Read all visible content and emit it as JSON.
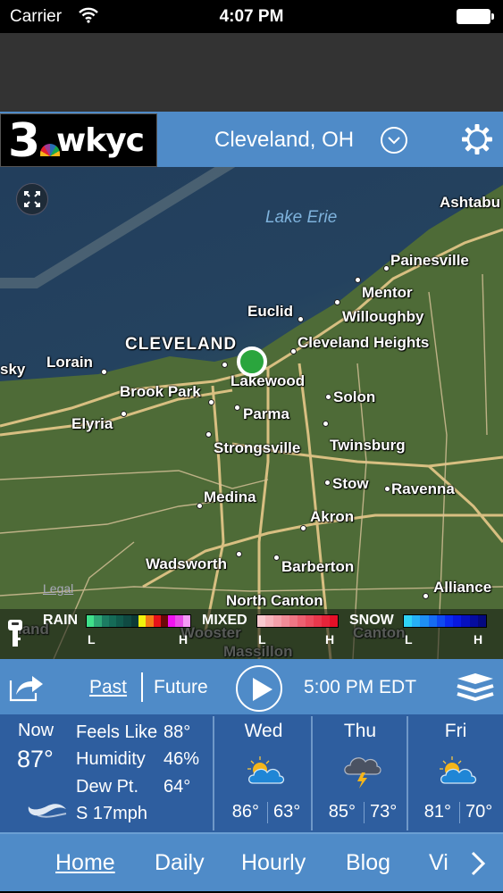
{
  "status_bar": {
    "carrier": "Carrier",
    "time": "4:07 PM",
    "wifi_icon": "wifi-icon",
    "battery_icon": "battery-icon"
  },
  "header": {
    "logo_number": "3",
    "logo_text": "wkyc",
    "location": "Cleveland, OH",
    "location_dropdown_icon": "chevron-down-circle-icon",
    "settings_icon": "gear-icon",
    "brand_color": "#4f8bc8"
  },
  "map": {
    "water_label": "Lake Erie",
    "expand_icon": "expand-icon",
    "legal_link": "Legal",
    "current_location_color": "#2aa53d",
    "cities": [
      {
        "name": "Ashtabu"
      },
      {
        "name": "Painesville"
      },
      {
        "name": "Mentor"
      },
      {
        "name": "Willoughby"
      },
      {
        "name": "Euclid"
      },
      {
        "name": "Cleveland Heights"
      },
      {
        "name": "CLEVELAND"
      },
      {
        "name": "Lorain"
      },
      {
        "name": "sky"
      },
      {
        "name": "Lakewood"
      },
      {
        "name": "Brook Park"
      },
      {
        "name": "Solon"
      },
      {
        "name": "Elyria"
      },
      {
        "name": "Parma"
      },
      {
        "name": "Strongsville"
      },
      {
        "name": "Twinsburg"
      },
      {
        "name": "Stow"
      },
      {
        "name": "Ravenna"
      },
      {
        "name": "Medina"
      },
      {
        "name": "Akron"
      },
      {
        "name": "Wadsworth"
      },
      {
        "name": "Barberton"
      },
      {
        "name": "North Canton"
      },
      {
        "name": "Alliance"
      },
      {
        "name": "Wooster"
      },
      {
        "name": "Massillon"
      },
      {
        "name": "Canton"
      },
      {
        "name": "land"
      }
    ]
  },
  "legend": {
    "key_icon": "key-icon",
    "rain": {
      "label": "RAIN",
      "low": "L",
      "high": "H",
      "colors": [
        "#3fe08a",
        "#2ea876",
        "#1c7c62",
        "#156b57",
        "#115a4c",
        "#0f4a42",
        "#0c3a36",
        "#f2f20c",
        "#f47b16",
        "#e8121a",
        "#6b0808",
        "#f012f0",
        "#e84ee8",
        "#f59bf5"
      ]
    },
    "mixed": {
      "label": "MIXED",
      "low": "L",
      "high": "H",
      "colors": [
        "#f9c9cf",
        "#f6b4bc",
        "#f3a0aa",
        "#f08b97",
        "#ee7684",
        "#ec6070",
        "#ea4c5e",
        "#e8384c",
        "#e6243a",
        "#e51028"
      ]
    },
    "snow": {
      "label": "SNOW",
      "low": "L",
      "high": "H",
      "colors": [
        "#2fd4f7",
        "#26b1f6",
        "#1e8ff5",
        "#166cf4",
        "#0f4af2",
        "#0a2af0",
        "#0818e0",
        "#0610c0",
        "#050ca0",
        "#040880"
      ]
    }
  },
  "controls": {
    "share_icon": "share-icon",
    "past_label": "Past",
    "future_label": "Future",
    "play_icon": "play-icon",
    "timestamp": "5:00 PM EDT",
    "layers_icon": "layers-icon"
  },
  "current": {
    "now_label": "Now",
    "temperature": "87°",
    "feels_like_label": "Feels Like",
    "feels_like_value": "88°",
    "humidity_label": "Humidity",
    "humidity_value": "46%",
    "dew_point_label": "Dew Pt.",
    "dew_point_value": "64°",
    "wind_icon": "wind-icon",
    "wind": "S 17mph"
  },
  "forecast": [
    {
      "day": "Wed",
      "icon": "partly-cloudy-icon",
      "high": "86°",
      "low": "63°"
    },
    {
      "day": "Thu",
      "icon": "thunderstorm-icon",
      "high": "85°",
      "low": "73°"
    },
    {
      "day": "Fri",
      "icon": "partly-cloudy-icon",
      "high": "81°",
      "low": "70°"
    }
  ],
  "nav": {
    "items": [
      {
        "label": "Home",
        "active": true
      },
      {
        "label": "Daily",
        "active": false
      },
      {
        "label": "Hourly",
        "active": false
      },
      {
        "label": "Blog",
        "active": false
      },
      {
        "label": "Vi",
        "active": false
      }
    ],
    "next_icon": "chevron-right-icon"
  }
}
